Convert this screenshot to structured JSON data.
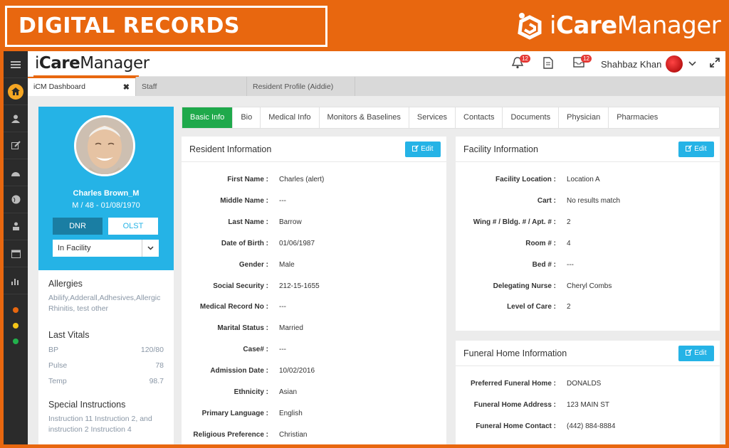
{
  "banner": {
    "title": "DIGITAL RECORDS",
    "logo_light": "i",
    "logo_bold": "Care",
    "logo_rest": "Manager"
  },
  "colors": {
    "orange": "#e8670f",
    "blue": "#25b3e6",
    "green": "#1fa94b"
  },
  "topbar": {
    "brand_light": "i",
    "brand_bold": "Care",
    "brand_rest": "Manager",
    "alerts_badge": "12",
    "messages_badge": "12",
    "user_name": "Shahbaz Khan"
  },
  "tabs": [
    {
      "label": "iCM Dashboard",
      "close": "✖"
    },
    {
      "label": "Staff"
    },
    {
      "label": "Resident Profile (Aiddie)"
    }
  ],
  "profile": {
    "name": "Charles Brown_M",
    "meta": "M / 48 - 01/08/1970",
    "dnr_label": "DNR",
    "olst_label": "OLST",
    "status_value": "In Facility"
  },
  "side": {
    "allergies_title": "Allergies",
    "allergies": "Abilify,Adderall,Adhesives,Allergic Rhinitis, test other",
    "vitals_title": "Last Vitals",
    "vitals": [
      {
        "label": "BP",
        "value": "120/80"
      },
      {
        "label": "Pulse",
        "value": "78"
      },
      {
        "label": "Temp",
        "value": "98.7"
      }
    ],
    "special_title": "Special Instructions",
    "special": "Instruction 11 Instruction 2, and instruction 2 Instruction 4"
  },
  "main_tabs": [
    "Basic Info",
    "Bio",
    "Medical Info",
    "Monitors & Baselines",
    "Services",
    "Contacts",
    "Documents",
    "Physician",
    "Pharmacies"
  ],
  "resident": {
    "title": "Resident Information",
    "edit_label": "Edit",
    "fields": [
      {
        "label": "First Name :",
        "value": "Charles (alert)"
      },
      {
        "label": "Middle Name :",
        "value": "---"
      },
      {
        "label": "Last Name :",
        "value": "Barrow"
      },
      {
        "label": "Date of Birth :",
        "value": "01/06/1987"
      },
      {
        "label": "Gender :",
        "value": "Male"
      },
      {
        "label": "Social Security :",
        "value": "212-15-1655"
      },
      {
        "label": "Medical Record No :",
        "value": "---"
      },
      {
        "label": "Marital Status :",
        "value": "Married"
      },
      {
        "label": "Case# :",
        "value": "---"
      },
      {
        "label": "Admission Date :",
        "value": "10/02/2016"
      },
      {
        "label": "Ethnicity :",
        "value": "Asian"
      },
      {
        "label": "Primary Language :",
        "value": "English"
      },
      {
        "label": "Religious Preference :",
        "value": "Christian"
      }
    ]
  },
  "facility": {
    "title": "Facility Information",
    "edit_label": "Edit",
    "fields": [
      {
        "label": "Facility Location :",
        "value": "Location A"
      },
      {
        "label": "Cart :",
        "value": "No results match"
      },
      {
        "label": "Wing # / Bldg. # / Apt. # :",
        "value": "2"
      },
      {
        "label": "Room # :",
        "value": "4"
      },
      {
        "label": "Bed # :",
        "value": "---"
      },
      {
        "label": "Delegating Nurse :",
        "value": "Cheryl Combs"
      },
      {
        "label": "Level of Care :",
        "value": "2"
      }
    ]
  },
  "funeral": {
    "title": "Funeral Home Information",
    "edit_label": "Edit",
    "fields": [
      {
        "label": "Preferred Funeral Home :",
        "value": "DONALDS"
      },
      {
        "label": "Funeral Home Address :",
        "value": "123 MAIN ST"
      },
      {
        "label": "Funeral Home Contact :",
        "value": "(442) 884-8884"
      }
    ]
  }
}
